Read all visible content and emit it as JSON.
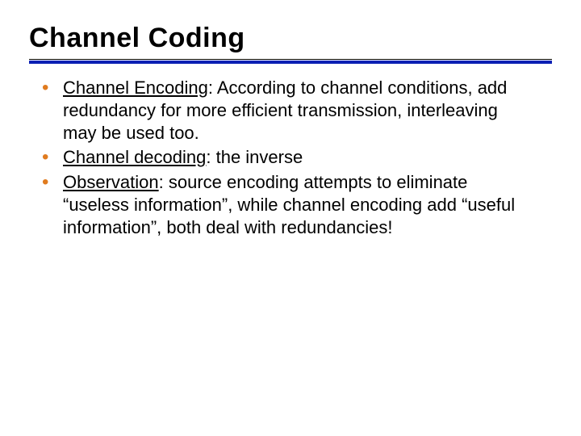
{
  "title": "Channel Coding",
  "bullets": [
    {
      "lead": "Channel Encoding",
      "rest": ": According to channel conditions, add redundancy for more efficient transmission, interleaving may be used too."
    },
    {
      "lead": "Channel decoding",
      "rest": ": the inverse"
    },
    {
      "lead": "Observation",
      "rest": ": source encoding attempts to eliminate “useless information”, while channel encoding add “useful information”, both deal with redundancies!"
    }
  ]
}
